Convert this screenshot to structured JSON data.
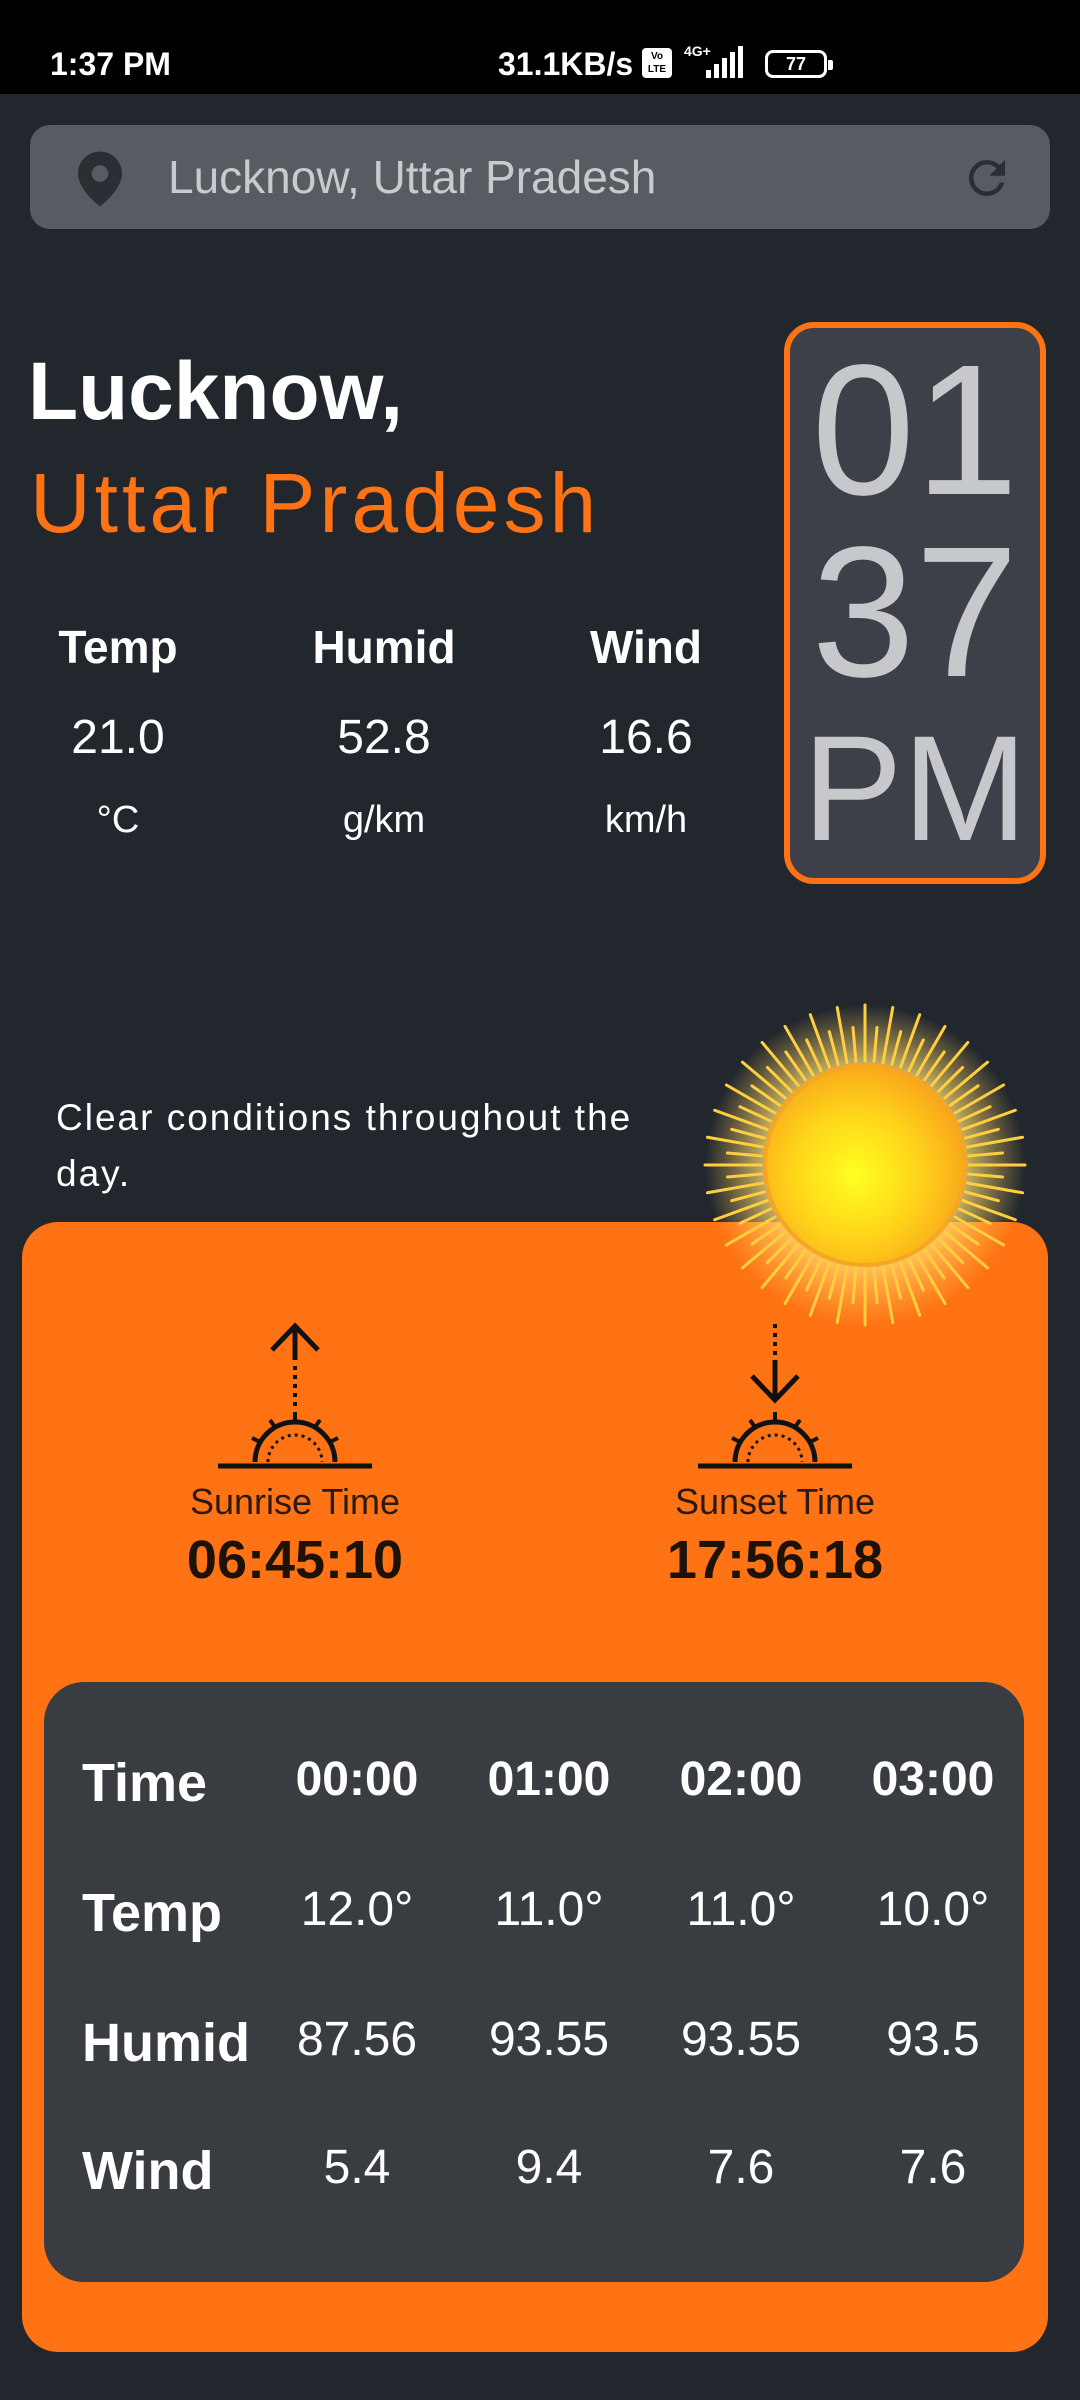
{
  "status_bar": {
    "time": "1:37 PM",
    "net_speed": "31.1KB/s",
    "volte_label": "Vo LTE",
    "network_label": "4G+",
    "battery_level": "77"
  },
  "search": {
    "placeholder": "Lucknow, Uttar Pradesh",
    "value": "Lucknow, Uttar Pradesh",
    "location_icon": "location-pin-icon",
    "refresh_icon": "refresh-icon"
  },
  "location": {
    "city": "Lucknow,",
    "state": "Uttar Pradesh"
  },
  "current": {
    "temp": {
      "label": "Temp",
      "value": "21.0",
      "unit": "°C"
    },
    "humid": {
      "label": "Humid",
      "value": "52.8",
      "unit": "g/km"
    },
    "wind": {
      "label": "Wind",
      "value": "16.6",
      "unit": "km/h"
    }
  },
  "clock": {
    "hour": "01",
    "minute": "37",
    "ampm": "PM"
  },
  "condition": "Clear conditions throughout the day.",
  "sun": {
    "sunrise_label": "Sunrise Time",
    "sunrise_time": "06:45:10",
    "sunset_label": "Sunset Time",
    "sunset_time": "17:56:18"
  },
  "forecast": {
    "row_headers": [
      "Time",
      "Temp",
      "Humid",
      "Wind"
    ],
    "times": [
      "00:00",
      "01:00",
      "02:00",
      "03:00"
    ],
    "temps": [
      "12.0°",
      "11.0°",
      "11.0°",
      "10.0°"
    ],
    "humid": [
      "87.56",
      "93.55",
      "93.55",
      "93.5"
    ],
    "wind": [
      "5.4",
      "9.4",
      "7.6",
      "7.6"
    ]
  },
  "colors": {
    "background": "#22272e",
    "accent": "#ff7315",
    "card_dark": "#393c40",
    "clock_bg": "#3d4048"
  }
}
